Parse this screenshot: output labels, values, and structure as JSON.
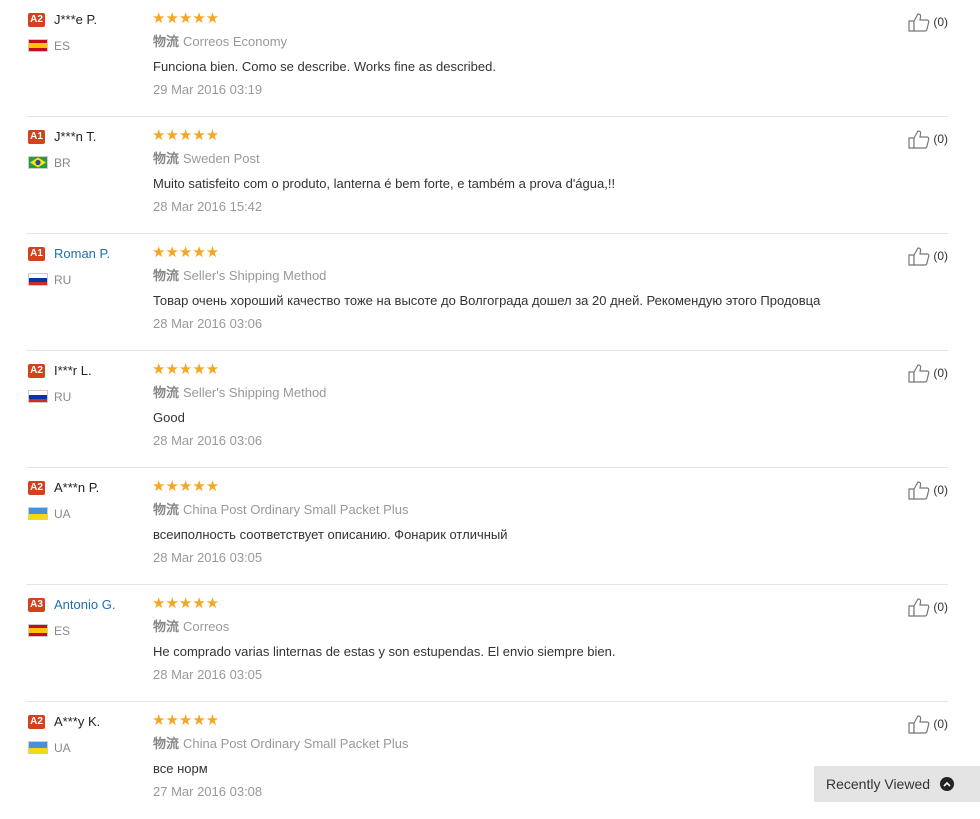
{
  "shipping_label": "物流",
  "colors": {
    "level_badge": "#d2421d",
    "star": "#f5a623",
    "link": "#1f6fb2"
  },
  "reviews": [
    {
      "level": "A2",
      "name": "J***e P.",
      "name_link": false,
      "country": "ES",
      "flag": "es",
      "stars": 5,
      "stars_text": "★★★★★",
      "shipping": "Correos Economy",
      "feedback": "Funciona bien. Como se describe. Works fine as described.",
      "date": "29 Mar 2016 03:19",
      "useful": "(0)"
    },
    {
      "level": "A1",
      "name": "J***n T.",
      "name_link": false,
      "country": "BR",
      "flag": "br",
      "stars": 5,
      "stars_text": "★★★★★",
      "shipping": "Sweden Post",
      "feedback": "Muito satisfeito com o produto, lanterna é bem forte, e também a prova d'água,!!",
      "date": "28 Mar 2016 15:42",
      "useful": "(0)"
    },
    {
      "level": "A1",
      "name": "Roman P.",
      "name_link": true,
      "country": "RU",
      "flag": "ru",
      "stars": 5,
      "stars_text": "★★★★★",
      "shipping": "Seller's Shipping Method",
      "feedback": "Товар очень хороший качество тоже на высоте до Волгограда дошел за 20 дней. Рекомендую этого Продовца",
      "date": "28 Mar 2016 03:06",
      "useful": "(0)"
    },
    {
      "level": "A2",
      "name": "I***r L.",
      "name_link": false,
      "country": "RU",
      "flag": "ru",
      "stars": 5,
      "stars_text": "★★★★★",
      "shipping": "Seller's Shipping Method",
      "feedback": "Good",
      "date": "28 Mar 2016 03:06",
      "useful": "(0)"
    },
    {
      "level": "A2",
      "name": "A***n P.",
      "name_link": false,
      "country": "UA",
      "flag": "ua",
      "stars": 5,
      "stars_text": "★★★★★",
      "shipping": "China Post Ordinary Small Packet Plus",
      "feedback": "всеиполность соответствует описанию. Фонарик отличный",
      "date": "28 Mar 2016 03:05",
      "useful": "(0)"
    },
    {
      "level": "A3",
      "name": "Antonio G.",
      "name_link": true,
      "country": "ES",
      "flag": "es",
      "stars": 5,
      "stars_text": "★★★★★",
      "shipping": "Correos",
      "feedback": "He comprado varias linternas de estas y son estupendas. El envio siempre bien.",
      "date": "28 Mar 2016 03:05",
      "useful": "(0)"
    },
    {
      "level": "A2",
      "name": "A***y K.",
      "name_link": false,
      "country": "UA",
      "flag": "ua",
      "stars": 5,
      "stars_text": "★★★★★",
      "shipping": "China Post Ordinary Small Packet Plus",
      "feedback": "все норм",
      "date": "27 Mar 2016 03:08",
      "useful": "(0)"
    }
  ],
  "recently_viewed": {
    "label": "Recently Viewed",
    "icon": "chevron-up-icon"
  }
}
